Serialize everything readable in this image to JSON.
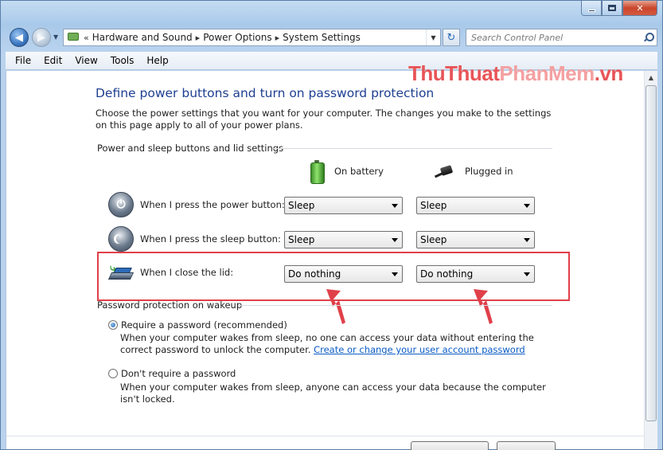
{
  "address": {
    "crumbs": [
      "Hardware and Sound",
      "Power Options",
      "System Settings"
    ],
    "overflow": "«"
  },
  "search": {
    "placeholder": "Search Control Panel"
  },
  "menu": [
    "File",
    "Edit",
    "View",
    "Tools",
    "Help"
  ],
  "watermark": {
    "part1": "ThuThuat",
    "part2": "PhanMem",
    "part3": ".vn"
  },
  "page": {
    "title": "Define power buttons and turn on password protection",
    "description": "Choose the power settings that you want for your computer. The changes you make to the settings on this page apply to all of your power plans."
  },
  "buttons_section": {
    "label": "Power and sleep buttons and lid settings",
    "col_battery": "On battery",
    "col_plugged": "Plugged in",
    "rows": [
      {
        "label": "When I press the power button:",
        "battery": "Sleep",
        "plugged": "Sleep",
        "icon": "power-icon"
      },
      {
        "label": "When I press the sleep button:",
        "battery": "Sleep",
        "plugged": "Sleep",
        "icon": "sleep-icon"
      },
      {
        "label": "When I close the lid:",
        "battery": "Do nothing",
        "plugged": "Do nothing",
        "icon": "laptop-lid-icon"
      }
    ]
  },
  "password_section": {
    "label": "Password protection on wakeup",
    "require_label": "Require a password (recommended)",
    "require_desc": "When your computer wakes from sleep, no one can access your data without entering the correct password to unlock the computer.",
    "require_link": "Create or change your user account password",
    "norequire_label": "Don't require a password",
    "norequire_desc": "When your computer wakes from sleep, anyone can access your data because the computer isn't locked.",
    "selected": "require"
  },
  "colors": {
    "title_blue": "#1e3f92",
    "annotation_red": "#e0404a",
    "link_blue": "#0a5bc4"
  }
}
